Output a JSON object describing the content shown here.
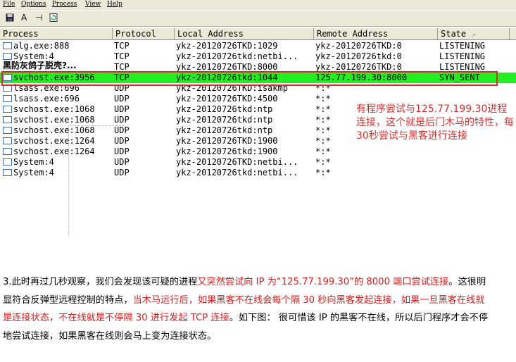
{
  "menu": {
    "file": "File",
    "options": "Options",
    "process": "Process",
    "view": "View",
    "help": "Help"
  },
  "toolbar": {
    "save_icon": "save-icon",
    "a_label": "A",
    "arrow_label": "⊣",
    "refresh_icon": "refresh-icon"
  },
  "columns": {
    "process": "Process",
    "protocol": "Protocol",
    "local": "Local Address",
    "remote": "Remote Address",
    "state": "State"
  },
  "rows": [
    {
      "process": "alg.exe:888",
      "protocol": "TCP",
      "local": "ykz-20120726TKD:1029",
      "remote": "ykz-20120726TKD:0",
      "state": "LISTENING"
    },
    {
      "process": "System:4",
      "protocol": "TCP",
      "local": "ykz-20120726tkd:netbi...",
      "remote": "ykz-20120726tkd:0",
      "state": "LISTENING"
    },
    {
      "process": "",
      "protocol": "TCP",
      "local": "ykz-20120726TKD:8000",
      "remote": "ykz-20120726TKD:0",
      "state": "LISTENING"
    },
    {
      "process": "svchost.exe:3956",
      "protocol": "TCP",
      "local": "ykz-20120726tkd:1044",
      "remote": "125.77.199.30:8000",
      "state": "SYN_SENT"
    },
    {
      "process": "lsass.exe:696",
      "protocol": "UDP",
      "local": "ykz-20120726TKD:isakmp",
      "remote": "*:*",
      "state": ""
    },
    {
      "process": "lsass.exe:696",
      "protocol": "UDP",
      "local": "ykz-20120726TKD:4500",
      "remote": "*:*",
      "state": ""
    },
    {
      "process": "svchost.exe:1068",
      "protocol": "UDP",
      "local": "ykz-20120726tkd:ntp",
      "remote": "*:*",
      "state": ""
    },
    {
      "process": "svchost.exe:1068",
      "protocol": "UDP",
      "local": "ykz-20120726tkd:ntp",
      "remote": "*:*",
      "state": ""
    },
    {
      "process": "svchost.exe:1068",
      "protocol": "UDP",
      "local": "ykz-20120726tkd:ntp",
      "remote": "*:*",
      "state": ""
    },
    {
      "process": "svchost.exe:1264",
      "protocol": "UDP",
      "local": "ykz-20120726TKD:1900",
      "remote": "*:*",
      "state": ""
    },
    {
      "process": "svchost.exe:1264",
      "protocol": "UDP",
      "local": "ykz-20120726tkd:1900",
      "remote": "*:*",
      "state": ""
    },
    {
      "process": "System:4",
      "protocol": "UDP",
      "local": "ykz-20120726TKD:netbi...",
      "remote": "*:*",
      "state": ""
    },
    {
      "process": "System:4",
      "protocol": "UDP",
      "local": "ykz-20120726tkd:netbi...",
      "remote": "*:*",
      "state": ""
    }
  ],
  "overlay_label": "黑防灰鸽子脱壳?...",
  "callout": "有程序尝试与125.77.199.30进程连接，这个就是后门木马的特性，每30秒尝试与黑客进行连接",
  "paragraph": {
    "p1": "3.此时再过几秒观察，我们会发现该可疑的进程",
    "p2": "又突然尝试向 IP 为“125.77.199.30”的 8000 端口尝试连接",
    "p3": "。这很明显符合反弹型远程控制的特点，",
    "p4": "当木马运行后，如果黑客不在线会每个隔 30 秒向黑客发起连接，如果一旦黑客在线就是连接状态，不在线就是不停隔 30 进行发起 TCP 连接",
    "p5": "。如下图： 很可惜该 IP 的黑客不在线，所以后门程序才会不停地尝试连接，如果黑客在线则会马上变为连接状态。"
  },
  "colors": {
    "highlight": "#22ee22",
    "annotation_red": "#d9292a"
  }
}
